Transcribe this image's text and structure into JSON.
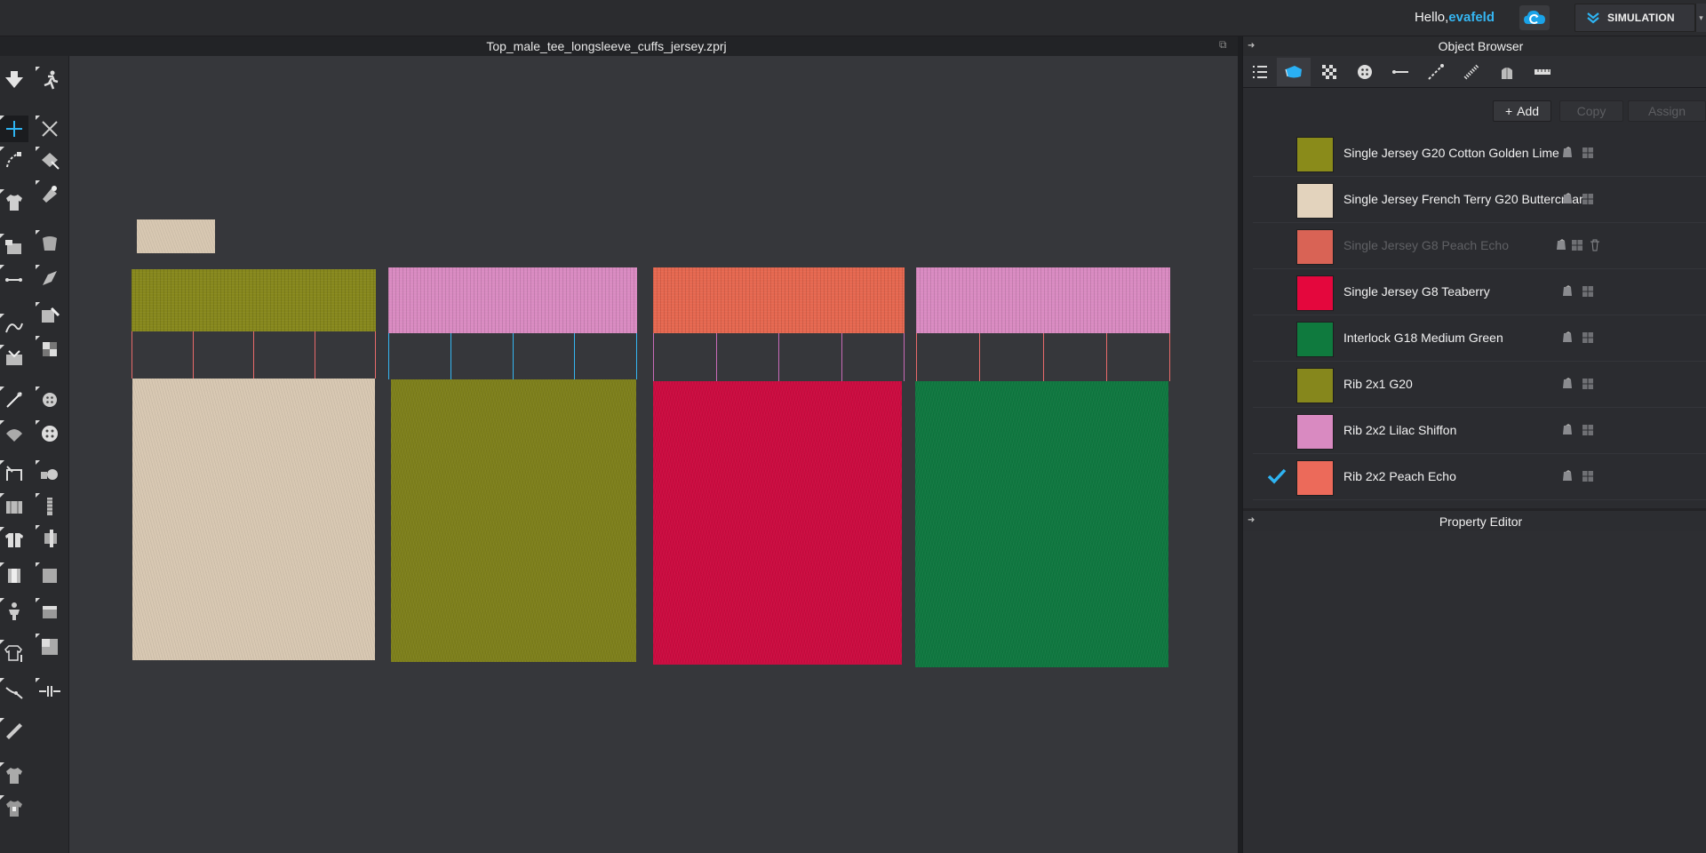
{
  "topbar": {
    "greeting_prefix": "Hello,",
    "username": "evafeld",
    "cloud_icon": "cloud-sync-icon",
    "simulation_label": "SIMULATION"
  },
  "viewport": {
    "title": "Top_male_tee_longsleeve_cuffs_jersey.zprj"
  },
  "object_browser": {
    "title": "Object Browser",
    "tabs": [
      "list-icon",
      "fabric-icon",
      "texture-icon",
      "button-icon",
      "buttonhole-icon",
      "topstitch-icon",
      "zipper-icon",
      "avatar-icon",
      "measure-icon"
    ],
    "active_tab": 1,
    "add_label": "Add",
    "copy_label": "Copy",
    "assign_label": "Assign",
    "fabrics": [
      {
        "name": "Single Jersey G20 Cotton Golden Lime",
        "color": "#8a8b1a",
        "selected": false,
        "dim": false
      },
      {
        "name": "Single Jersey French Terry G20 Buttercream",
        "color": "#e3d3bd",
        "selected": false,
        "dim": false
      },
      {
        "name": "Single Jersey G8 Peach Echo",
        "color": "#ec6a5a",
        "selected": false,
        "dim": true
      },
      {
        "name": "Single Jersey G8 Teaberry",
        "color": "#e4073d",
        "selected": false,
        "dim": false
      },
      {
        "name": "Interlock G18 Medium Green",
        "color": "#0f7a3e",
        "selected": false,
        "dim": false
      },
      {
        "name": "Rib 2x1 G20",
        "color": "#86871c",
        "selected": false,
        "dim": false
      },
      {
        "name": "Rib 2x2 Lilac Shiffon",
        "color": "#d98ac1",
        "selected": false,
        "dim": false
      },
      {
        "name": "Rib 2x2 Peach Echo",
        "color": "#ec6a5a",
        "selected": true,
        "dim": false
      }
    ]
  },
  "property_editor": {
    "title": "Property Editor"
  },
  "colors": {
    "accent": "#35b6f2",
    "panel_bg": "#2a2b2e",
    "viewport_bg": "#36373b"
  },
  "pattern_pieces": {
    "cuffs": [
      "#86871c",
      "#d98ac1",
      "#e5674f",
      "#d98ac1"
    ],
    "bodies": [
      "#d8c8b2",
      "#7e801b",
      "#cc0b40",
      "#0f7840"
    ],
    "sewing_lines": [
      "#e86a6a",
      "#35b6f2",
      "#c86ab8",
      "#e86a6a"
    ]
  }
}
